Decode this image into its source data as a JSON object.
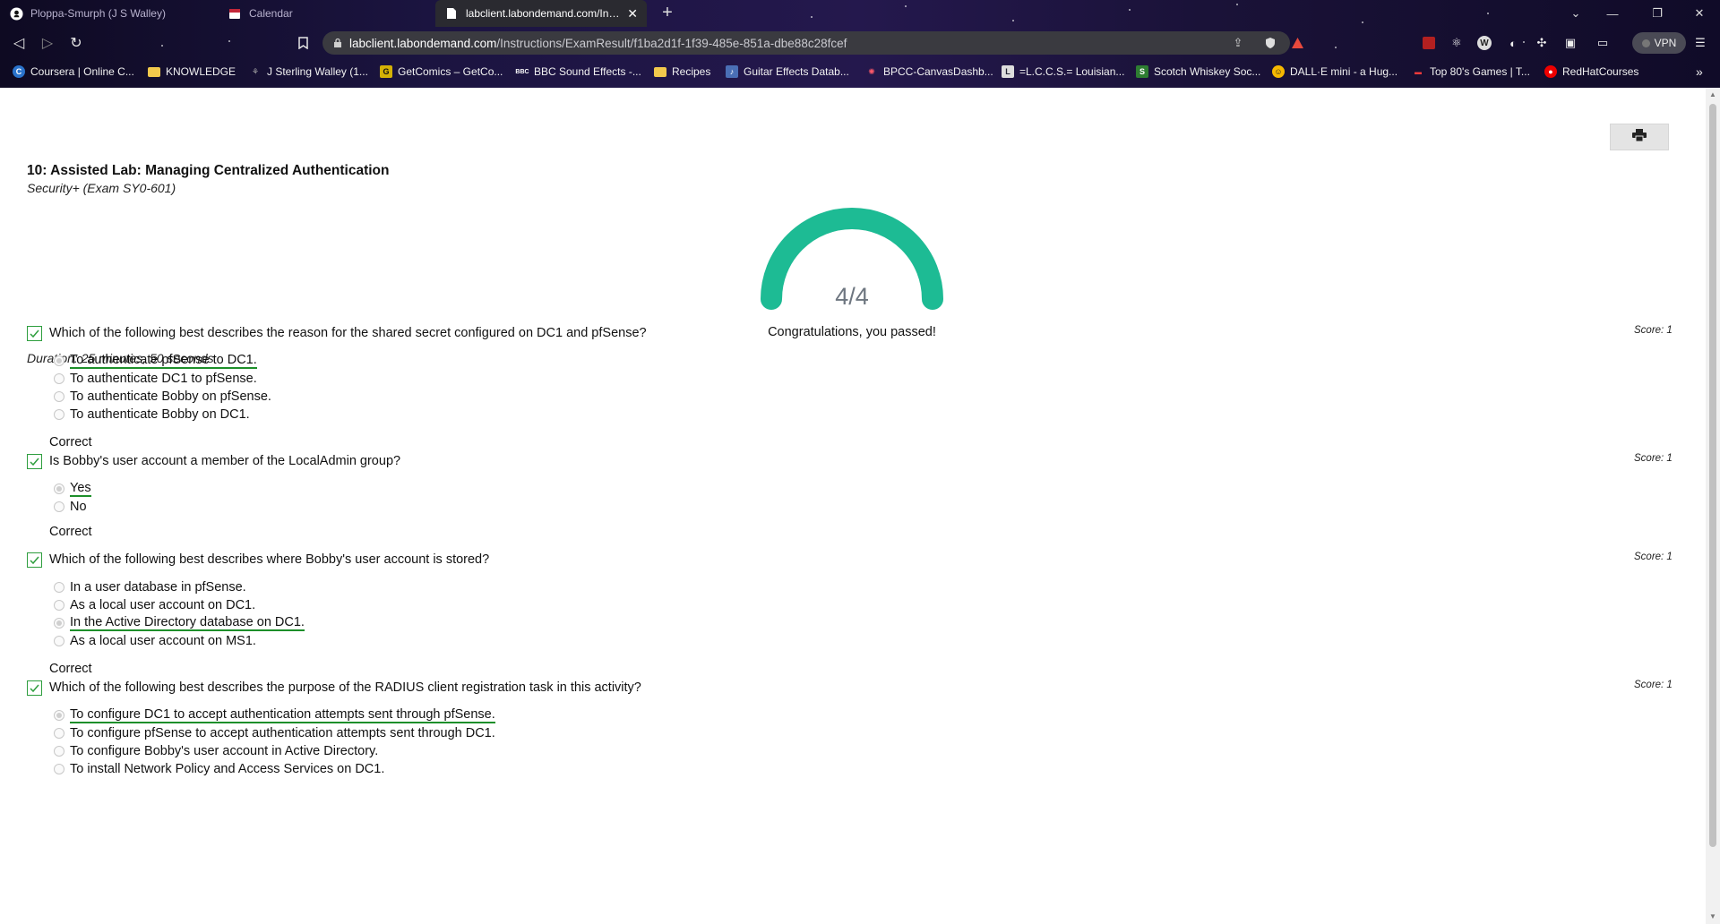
{
  "browser": {
    "tabs": [
      {
        "title": "Ploppa-Smurph (J S Walley)",
        "icon": "github-icon",
        "active": false
      },
      {
        "title": "Calendar",
        "icon": "calendar-icon",
        "active": false
      },
      {
        "title": "labclient.labondemand.com/Instr",
        "icon": "document-icon",
        "active": true
      }
    ],
    "url": {
      "host": "labclient.labondemand.com",
      "path": "/Instructions/ExamResult/f1ba2d1f-1f39-485e-851a-dbe88c28fcef"
    },
    "vpn_label": "VPN",
    "bookmarks": [
      {
        "label": "Coursera | Online C...",
        "icon": "coursera-icon",
        "color": "#2a73cc"
      },
      {
        "label": "KNOWLEDGE",
        "icon": "folder-icon",
        "color": "#f2c94c"
      },
      {
        "label": "J Sterling Walley (1...",
        "icon": "bookmark-icon",
        "color": "#888888"
      },
      {
        "label": "GetComics – GetCo...",
        "icon": "getcomics-icon",
        "color": "#d4b106"
      },
      {
        "label": "BBC Sound Effects -...",
        "icon": "bbc-icon",
        "color": "#333333"
      },
      {
        "label": "Recipes",
        "icon": "folder-icon",
        "color": "#f2c94c"
      },
      {
        "label": "Guitar Effects Datab...",
        "icon": "guitar-icon",
        "color": "#4a6fb5"
      },
      {
        "label": "BPCC-CanvasDashb...",
        "icon": "canvas-icon",
        "color": "#c2273a"
      },
      {
        "label": "=L.C.C.S.= Louisian...",
        "icon": "lccs-icon",
        "color": "#dddddd"
      },
      {
        "label": "Scotch Whiskey Soc...",
        "icon": "whiskey-icon",
        "color": "#2e7d32"
      },
      {
        "label": "DALL·E mini - a Hug...",
        "icon": "huggingface-icon",
        "color": "#f5b800"
      },
      {
        "label": "Top 80's Games | T...",
        "icon": "games-icon",
        "color": "#cc2222"
      },
      {
        "label": "RedHatCourses",
        "icon": "redhat-icon",
        "color": "#ee0000"
      }
    ]
  },
  "page": {
    "print_label": "Print",
    "title": "10: Assisted Lab: Managing Centralized Authentication",
    "subtitle": "Security+ (Exam SY0-601)",
    "score": {
      "display": "4/4",
      "earned": 4,
      "total": 4,
      "color": "#1dbb94"
    },
    "message": "Congratulations, you passed!",
    "duration": "Duration: 25 minutes, 50 seconds",
    "questions": [
      {
        "text": "Which of the following best describes the reason for the shared secret configured on DC1 and pfSense?",
        "score": "Score: 1",
        "options": [
          {
            "label": "To authenticate pfSense to DC1.",
            "selected": true,
            "correct": true
          },
          {
            "label": "To authenticate DC1 to pfSense.",
            "selected": false,
            "correct": false
          },
          {
            "label": "To authenticate Bobby on pfSense.",
            "selected": false,
            "correct": false
          },
          {
            "label": "To authenticate Bobby on DC1.",
            "selected": false,
            "correct": false
          }
        ],
        "result": "Correct"
      },
      {
        "text": "Is Bobby's user account a member of the LocalAdmin group?",
        "score": "Score: 1",
        "options": [
          {
            "label": "Yes",
            "selected": true,
            "correct": true
          },
          {
            "label": "No",
            "selected": false,
            "correct": false
          }
        ],
        "result": "Correct"
      },
      {
        "text": "Which of the following best describes where Bobby's user account is stored?",
        "score": "Score: 1",
        "options": [
          {
            "label": "In a user database in pfSense.",
            "selected": false,
            "correct": false
          },
          {
            "label": "As a local user account on DC1.",
            "selected": false,
            "correct": false
          },
          {
            "label": "In the Active Directory database on DC1.",
            "selected": true,
            "correct": true
          },
          {
            "label": "As a local user account on MS1.",
            "selected": false,
            "correct": false
          }
        ],
        "result": "Correct"
      },
      {
        "text": "Which of the following best describes the purpose of the RADIUS client registration task in this activity?",
        "score": "Score: 1",
        "options": [
          {
            "label": "To configure DC1 to accept authentication attempts sent through pfSense.",
            "selected": true,
            "correct": true
          },
          {
            "label": "To configure pfSense to accept authentication attempts sent through DC1.",
            "selected": false,
            "correct": false
          },
          {
            "label": "To configure Bobby's user account in Active Directory.",
            "selected": false,
            "correct": false
          },
          {
            "label": "To install Network Policy and Access Services on DC1.",
            "selected": false,
            "correct": false
          }
        ],
        "result": ""
      }
    ]
  }
}
